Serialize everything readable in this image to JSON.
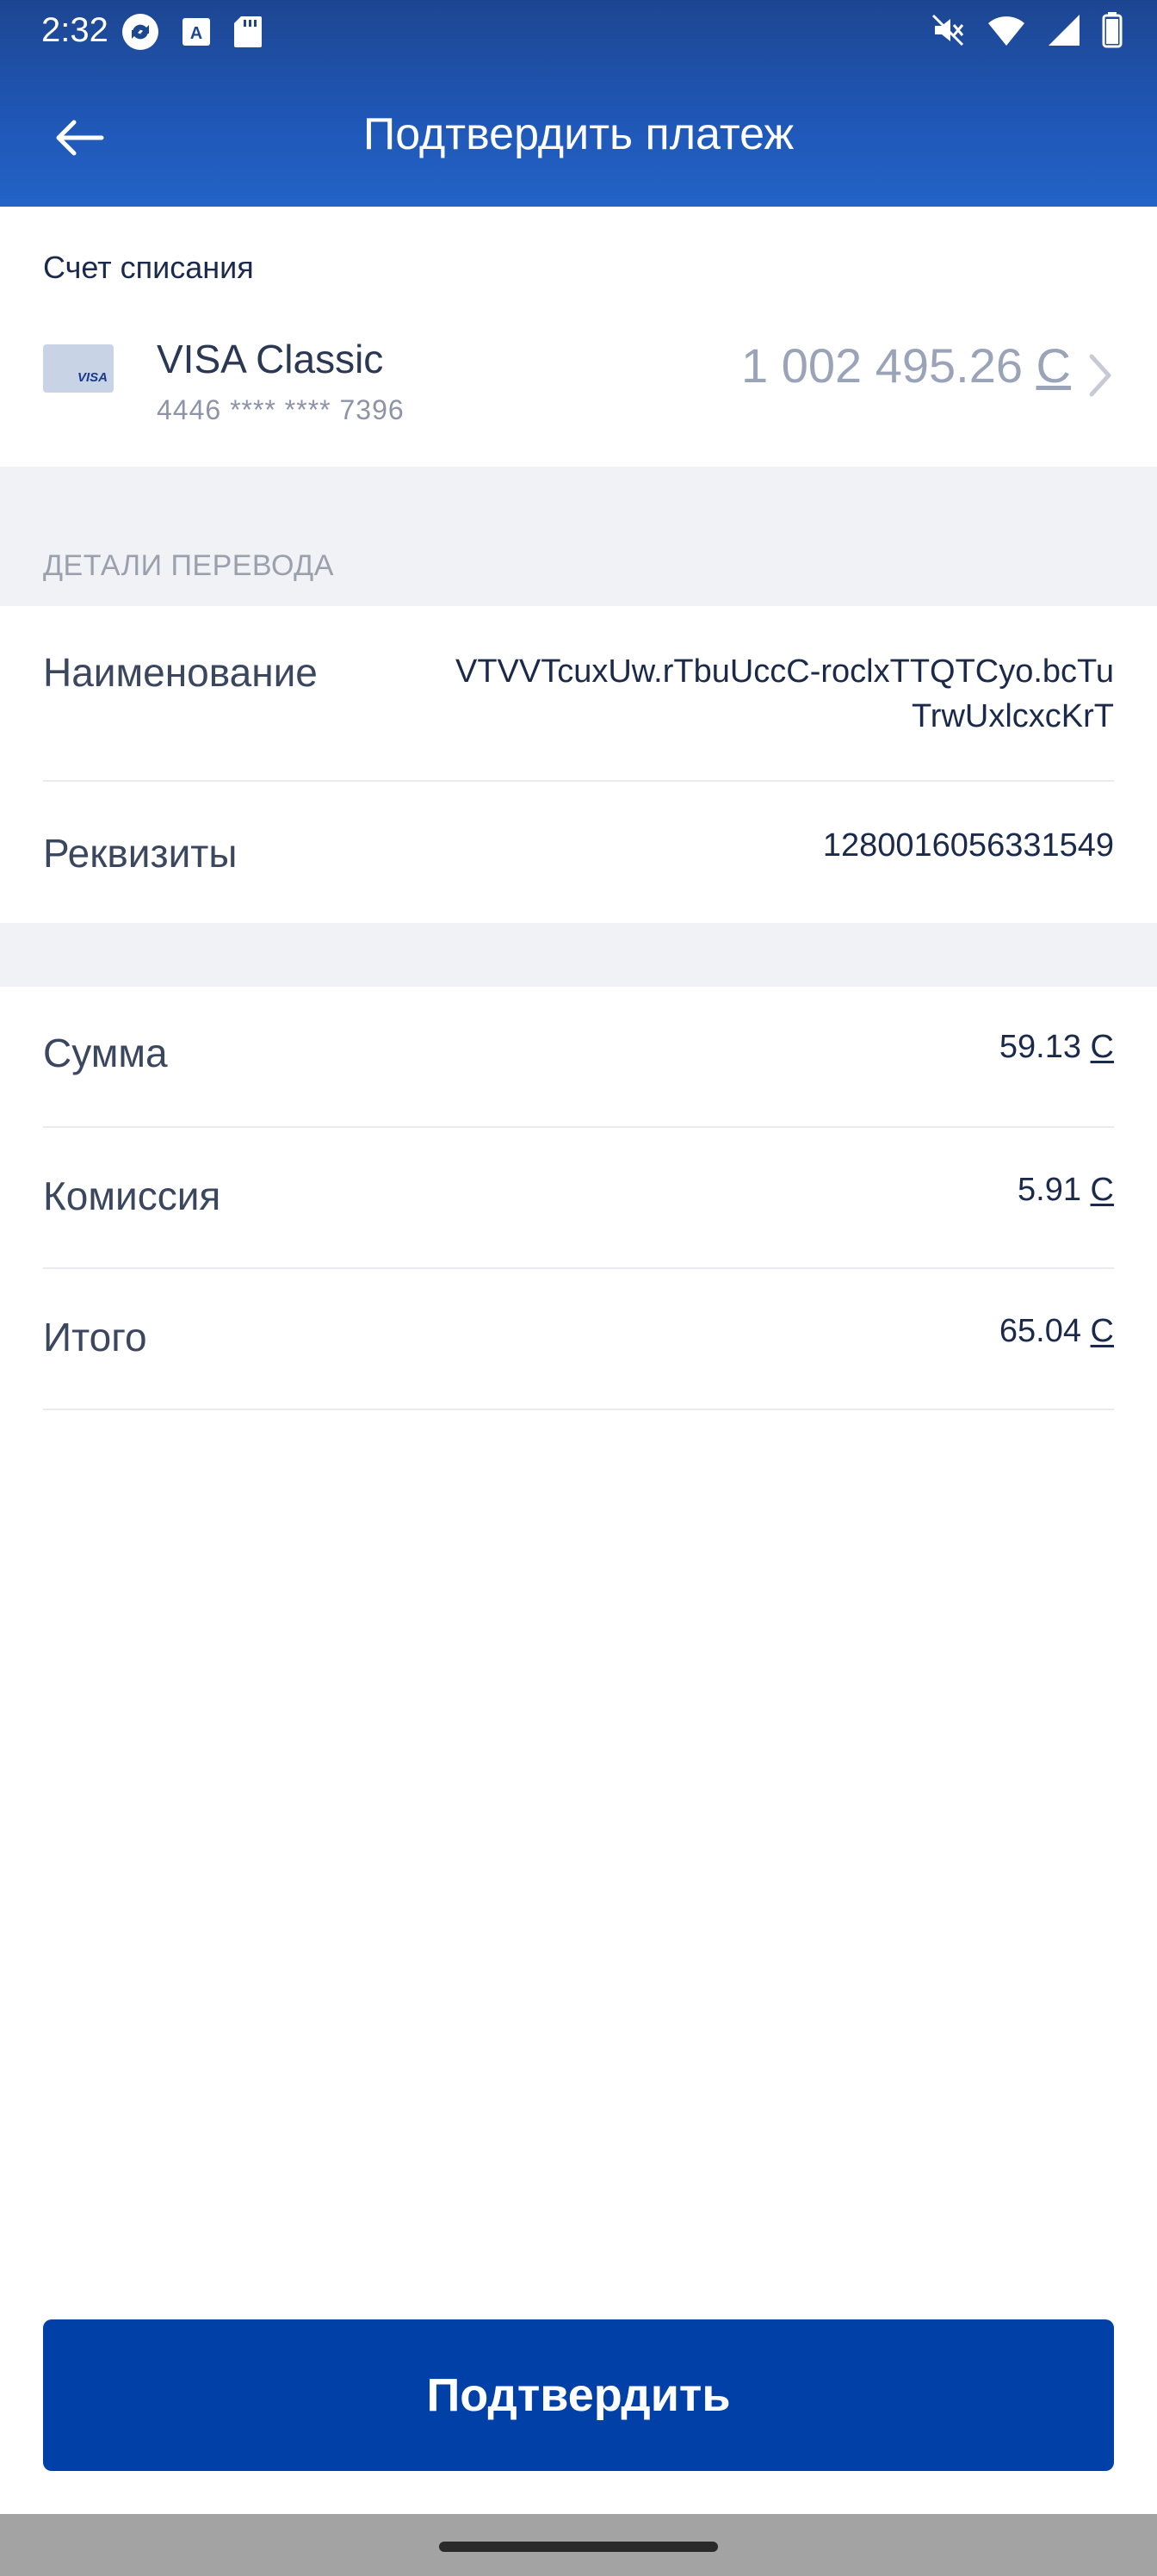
{
  "status_bar": {
    "time": "2:32",
    "left_icons": [
      "sync-icon",
      "text-a-icon",
      "sd-card-icon"
    ],
    "right_icons": [
      "mute-icon",
      "wifi-icon",
      "signal-icon",
      "battery-icon"
    ]
  },
  "toolbar": {
    "title": "Подтвердить платеж",
    "back_icon": "arrow-left-icon"
  },
  "account": {
    "label": "Счет списания",
    "card_brand": "VISA",
    "card_name": "VISA Classic",
    "card_number": "4446 **** **** 7396",
    "balance": "1 002 495.26",
    "currency": "С"
  },
  "details": {
    "header": "ДЕТАЛИ ПЕРЕВОДА",
    "name_label": "Наименование",
    "name_value_line1": "VTVVTcuxUw.rTbuUccC-roclxTTQTCyo.bcTu",
    "name_value_line2": "TrwUxlcxcKrT",
    "requisites_label": "Реквизиты",
    "requisites_value": "1280016056331549"
  },
  "summary": {
    "amount_label": "Сумма",
    "amount_value": "59.13",
    "fee_label": "Комиссия",
    "fee_value": "5.91",
    "total_label": "Итого",
    "total_value": "65.04",
    "currency": "С"
  },
  "confirm_button": {
    "label": "Подтвердить"
  },
  "colors": {
    "header_blue": "#1f56b5",
    "button_blue": "#0141a7",
    "band_grey": "#f0f2f5"
  }
}
